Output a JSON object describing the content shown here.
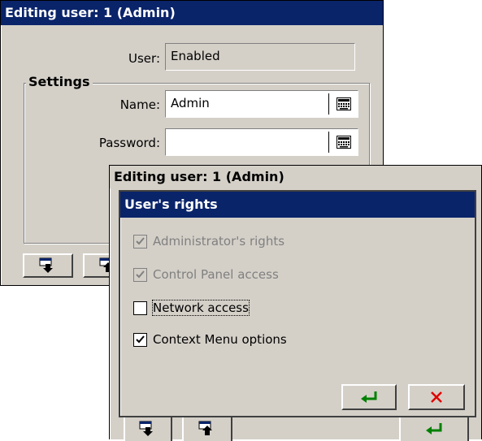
{
  "back_window": {
    "title": "Editing user: 1 (Admin)",
    "user_label": "User:",
    "user_value": "Enabled",
    "settings_legend": "Settings",
    "name_label": "Name:",
    "name_value": "Admin",
    "password_label": "Password:",
    "password_value": ""
  },
  "middle_window": {
    "title": "Editing user: 1 (Admin)"
  },
  "rights_dialog": {
    "title": "User's rights",
    "items": [
      {
        "label": "Administrator's rights",
        "checked": true,
        "enabled": false
      },
      {
        "label": "Control Panel access",
        "checked": true,
        "enabled": false
      },
      {
        "label": "Network access",
        "checked": false,
        "enabled": true,
        "focused": true
      },
      {
        "label": "Context Menu options",
        "checked": true,
        "enabled": true
      }
    ]
  },
  "colors": {
    "title_bg": "#0a246a",
    "window_bg": "#d4d0c8",
    "ok_green": "#008000",
    "cancel_red": "#e00000"
  },
  "icons": {
    "keyboard": "keyboard-icon",
    "save_down": "save-down-icon",
    "load_up": "load-up-icon",
    "ok": "enter-arrow-icon",
    "cancel": "close-x-icon"
  }
}
